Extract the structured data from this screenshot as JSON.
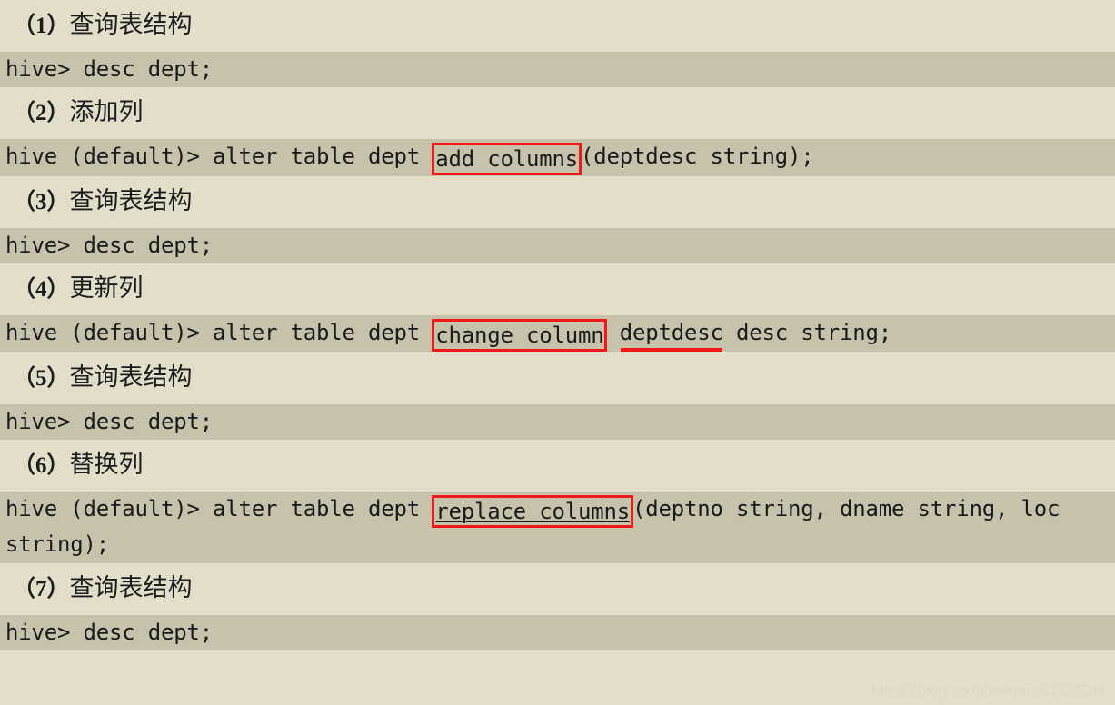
{
  "document": {
    "background_color": "#e3dec9",
    "code_background_color": "#c6c2ab",
    "annotation_color": "#f01818",
    "text_color": "#1a1a1a"
  },
  "sections": [
    {
      "heading_paren_open": "（",
      "heading_number": "1",
      "heading_paren_close": "）",
      "heading_text": "查询表结构",
      "code": "hive> desc dept;"
    },
    {
      "heading_paren_open": "（",
      "heading_number": "2",
      "heading_paren_close": "）",
      "heading_text": "添加列",
      "code_before": "hive (default)> alter table dept ",
      "code_boxed": "add columns",
      "code_after": "(deptdesc string);"
    },
    {
      "heading_paren_open": "（",
      "heading_number": "3",
      "heading_paren_close": "）",
      "heading_text": "查询表结构",
      "code": "hive> desc dept;"
    },
    {
      "heading_paren_open": "（",
      "heading_number": "4",
      "heading_paren_close": "）",
      "heading_text": "更新列",
      "code_before": "hive (default)> alter table dept ",
      "code_boxed": "change column",
      "code_mid": " ",
      "code_underlined_red": "deptdesc",
      "code_after": " desc string;"
    },
    {
      "heading_paren_open": "（",
      "heading_number": "5",
      "heading_paren_close": "）",
      "heading_text": "查询表结构",
      "code": "hive> desc dept;"
    },
    {
      "heading_paren_open": "（",
      "heading_number": "6",
      "heading_paren_close": "）",
      "heading_text": "替换列",
      "code_before": "hive (default)> alter table dept ",
      "code_boxed": "replace columns",
      "code_after": "(deptno string, dname string, loc string);"
    },
    {
      "heading_paren_open": "（",
      "heading_number": "7",
      "heading_paren_close": "）",
      "heading_text": "查询表结构",
      "code": "hive> desc dept;"
    }
  ],
  "watermark": {
    "text": "https://blog.csdn.net/nmsLLCSDN"
  }
}
